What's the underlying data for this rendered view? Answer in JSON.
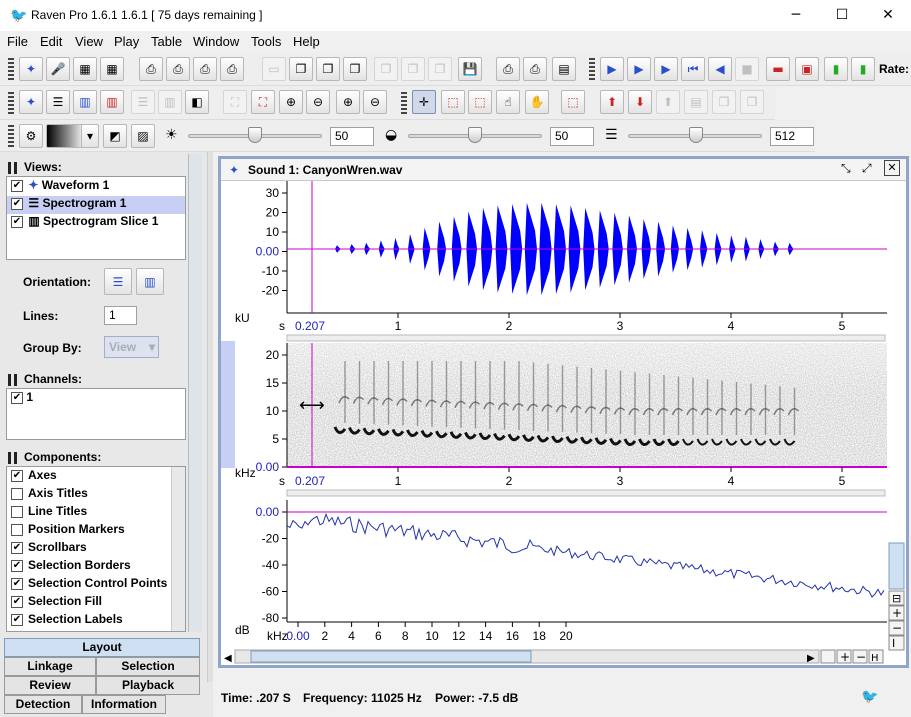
{
  "window": {
    "title": "Raven Pro 1.6.1 1.6.1  [ 75 days remaining ]",
    "minimize": "─",
    "maximize": "☐",
    "close": "✕"
  },
  "menu": [
    "File",
    "Edit",
    "View",
    "Play",
    "Table",
    "Window",
    "Tools",
    "Help"
  ],
  "toolbar1": {
    "rate_label": "Rate:"
  },
  "toolbar3": {
    "brightness_value": "50",
    "contrast_value": "50",
    "size_value": "512",
    "brightness_level": 50,
    "contrast_level": 50
  },
  "views": {
    "header": "Views:",
    "items": [
      {
        "label": "Waveform 1",
        "checked": true,
        "selected": false
      },
      {
        "label": "Spectrogram 1",
        "checked": true,
        "selected": true
      },
      {
        "label": "Spectrogram Slice 1",
        "checked": true,
        "selected": false
      }
    ],
    "orientation_label": "Orientation:",
    "lines_label": "Lines:",
    "lines_value": "1",
    "group_by_label": "Group By:",
    "group_by_value": "View"
  },
  "channels": {
    "header": "Channels:",
    "items": [
      {
        "label": "1",
        "checked": true
      }
    ]
  },
  "components": {
    "header": "Components:",
    "items": [
      {
        "label": "Axes",
        "checked": true
      },
      {
        "label": "Axis Titles",
        "checked": false
      },
      {
        "label": "Line Titles",
        "checked": false
      },
      {
        "label": "Position Markers",
        "checked": false
      },
      {
        "label": "Scrollbars",
        "checked": true
      },
      {
        "label": "Selection Borders",
        "checked": true
      },
      {
        "label": "Selection Control Points",
        "checked": true
      },
      {
        "label": "Selection Fill",
        "checked": true
      },
      {
        "label": "Selection Labels",
        "checked": true
      }
    ]
  },
  "tabs": {
    "layout": "Layout",
    "linkage": "Linkage",
    "selection": "Selection",
    "review": "Review",
    "playback": "Playback",
    "detection": "Detection",
    "information": "Information"
  },
  "sound_window": {
    "title": "Sound 1: CanyonWren.wav"
  },
  "waveform": {
    "y_ticks": [
      "30",
      "20",
      "10",
      "0.00",
      "-10",
      "-20"
    ],
    "y_unit": "kU",
    "x_unit": "s",
    "x_cursor_label": "0.207",
    "x_ticks": [
      "1",
      "2",
      "3",
      "4",
      "5"
    ],
    "cursor_time": 0.207,
    "color": "#0000ff"
  },
  "spectrogram": {
    "y_ticks": [
      "20",
      "15",
      "10",
      "5",
      "0.00"
    ],
    "y_unit": "kHz",
    "x_unit": "s",
    "x_cursor_label": "0.207",
    "x_ticks": [
      "1",
      "2",
      "3",
      "4",
      "5"
    ]
  },
  "slice": {
    "y_ticks": [
      "0.00",
      "-20",
      "-40",
      "-60",
      "-80"
    ],
    "y_unit": "dB",
    "x_unit": "kHz",
    "x_ticks": [
      "0.00",
      "2",
      "4",
      "6",
      "8",
      "10",
      "12",
      "14",
      "16",
      "18",
      "20"
    ],
    "color": "#2233aa"
  },
  "status": {
    "time": "Time: .207 S",
    "frequency": "Frequency: 11025 Hz",
    "power": "Power: -7.5 dB"
  },
  "colors": {
    "cursor": "#cc00cc",
    "selection": "#c8cff5",
    "frame_border": "#8fa6c8"
  }
}
